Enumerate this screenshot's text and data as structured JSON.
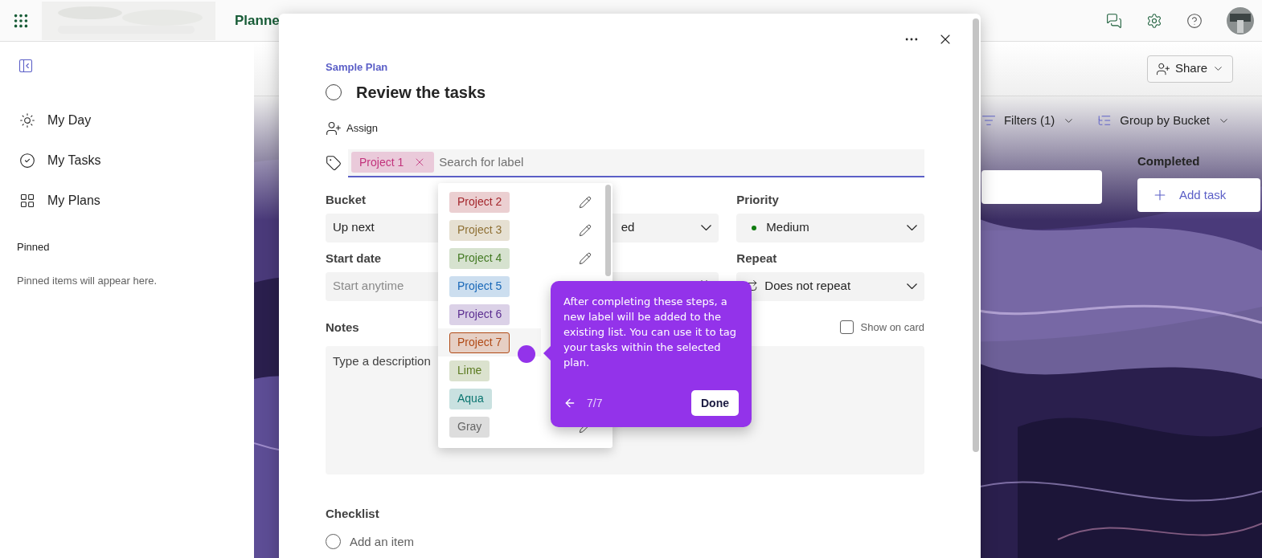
{
  "top_bar": {
    "app_name": "Planne"
  },
  "sidebar": {
    "items": [
      {
        "label": "My Day",
        "kind": "day"
      },
      {
        "label": "My Tasks",
        "kind": "tasks"
      },
      {
        "label": "My Plans",
        "kind": "plans"
      }
    ],
    "pinned_title": "Pinned",
    "pinned_empty": "Pinned items will appear here."
  },
  "board": {
    "share": "Share",
    "filters": "Filters (1)",
    "group_by": "Group by Bucket",
    "completed_heading": "Completed",
    "add_task": "Add task"
  },
  "task": {
    "plan": "Sample Plan",
    "title": "Review the tasks",
    "completed": false,
    "assign": "Assign",
    "applied_label": {
      "text": "Project 1",
      "color": "#c2337c"
    },
    "label_search_placeholder": "Search for label",
    "fields": [
      {
        "label": "Bucket",
        "value": "Up next",
        "kind": "plain"
      },
      {
        "value": "ed",
        "kind": "dropdown"
      },
      {
        "label": "Priority",
        "value": "Medium",
        "kind": "priority",
        "color": "#107c10"
      },
      {
        "label": "Start date",
        "placeholder": "Start anytime",
        "kind": "plain"
      },
      {
        "kind": "date"
      },
      {
        "label": "Repeat",
        "value": "Does not repeat",
        "kind": "repeat"
      }
    ],
    "notes_label": "Notes",
    "show_on_card": {
      "label": "Show on card",
      "checked": false
    },
    "notes_placeholder": "Type a description",
    "checklist_label": "Checklist",
    "checklist_placeholder": "Add an item"
  },
  "label_menu": [
    {
      "text": "Project 2",
      "color": "#a4262c",
      "selected": false,
      "edit_icon": true
    },
    {
      "text": "Project 3",
      "color": "#8f7034",
      "selected": false,
      "edit_icon": true
    },
    {
      "text": "Project 4",
      "color": "#437a23",
      "selected": false,
      "edit_icon": true
    },
    {
      "text": "Project 5",
      "color": "#1968b8",
      "selected": false,
      "edit_icon": false
    },
    {
      "text": "Project 6",
      "color": "#5c2e91",
      "selected": false,
      "edit_icon": false
    },
    {
      "text": "Project 7",
      "color": "#b14a16",
      "selected": true,
      "edit_icon": false
    },
    {
      "text": "Lime",
      "color": "#5b7a1f",
      "selected": false,
      "edit_icon": false
    },
    {
      "text": "Aqua",
      "color": "#0a7570",
      "selected": false,
      "edit_icon": false
    },
    {
      "text": "Gray",
      "color": "#666666",
      "selected": false,
      "edit_icon": true
    }
  ],
  "tour_tip": {
    "text": "After completing these steps, a new label will be added to the existing list. You can use it to tag your tasks within the selected plan.",
    "step": "7/7",
    "done": "Done"
  }
}
